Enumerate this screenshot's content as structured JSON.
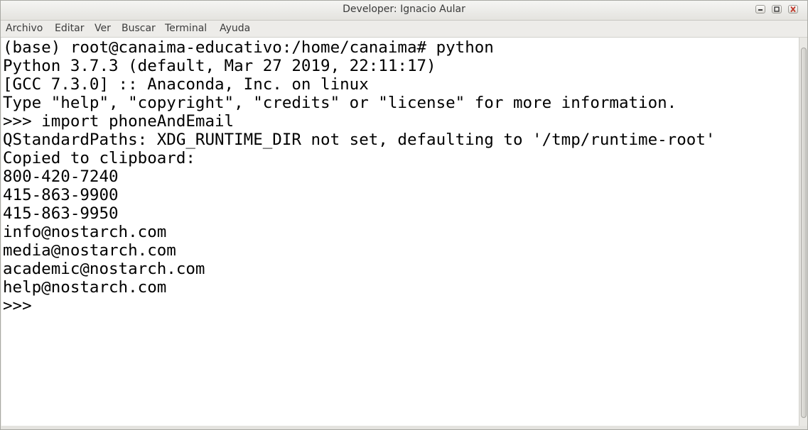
{
  "window": {
    "title": "Developer: Ignacio Aular"
  },
  "menubar": {
    "items": [
      "Archivo",
      "Editar",
      "Ver",
      "Buscar",
      "Terminal",
      "Ayuda"
    ]
  },
  "terminal": {
    "lines": [
      "(base) root@canaima-educativo:/home/canaima# python",
      "Python 3.7.3 (default, Mar 27 2019, 22:11:17)",
      "[GCC 7.3.0] :: Anaconda, Inc. on linux",
      "Type \"help\", \"copyright\", \"credits\" or \"license\" for more information.",
      ">>> import phoneAndEmail",
      "QStandardPaths: XDG_RUNTIME_DIR not set, defaulting to '/tmp/runtime-root'",
      "Copied to clipboard:",
      "800-420-7240",
      "415-863-9900",
      "415-863-9950",
      "info@nostarch.com",
      "media@nostarch.com",
      "academic@nostarch.com",
      "help@nostarch.com",
      ">>>"
    ]
  },
  "icons": {
    "minimize": "minimize-icon",
    "maximize": "maximize-icon",
    "close": "close-icon"
  },
  "colors": {
    "close_accent": "#c0392b",
    "terminal_bg": "#ffffff",
    "terminal_fg": "#000000"
  }
}
